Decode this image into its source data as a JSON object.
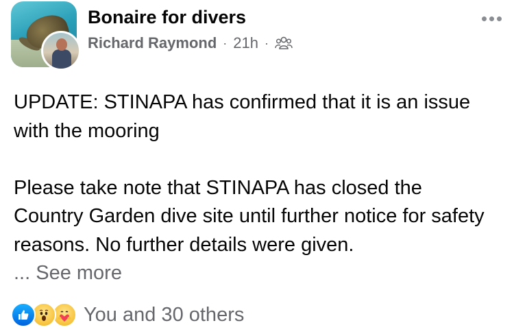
{
  "header": {
    "group_name": "Bonaire for divers",
    "author": "Richard Raymond",
    "separator": "·",
    "time": "21h",
    "audience_icon": "members-icon",
    "group_avatar_icon": "sea-turtle-photo",
    "author_avatar_icon": "person-photo",
    "more_icon": "more-options-icon"
  },
  "post": {
    "paragraph1": "UPDATE: STINAPA has confirmed that it is an issue with the mooring",
    "paragraph2": "Please take note that STINAPA has closed the Country Garden dive site until further notice for safety reasons. No further details were given.",
    "see_more": "... See more"
  },
  "reactions": {
    "icons": [
      "like-icon",
      "wow-icon",
      "care-icon"
    ],
    "summary": "You and 30 others"
  },
  "colors": {
    "text_primary": "#050505",
    "text_secondary": "#65676b",
    "like_blue": "#1877f2",
    "reaction_yellow": "#f7c23a",
    "heart_red": "#f33e58"
  }
}
